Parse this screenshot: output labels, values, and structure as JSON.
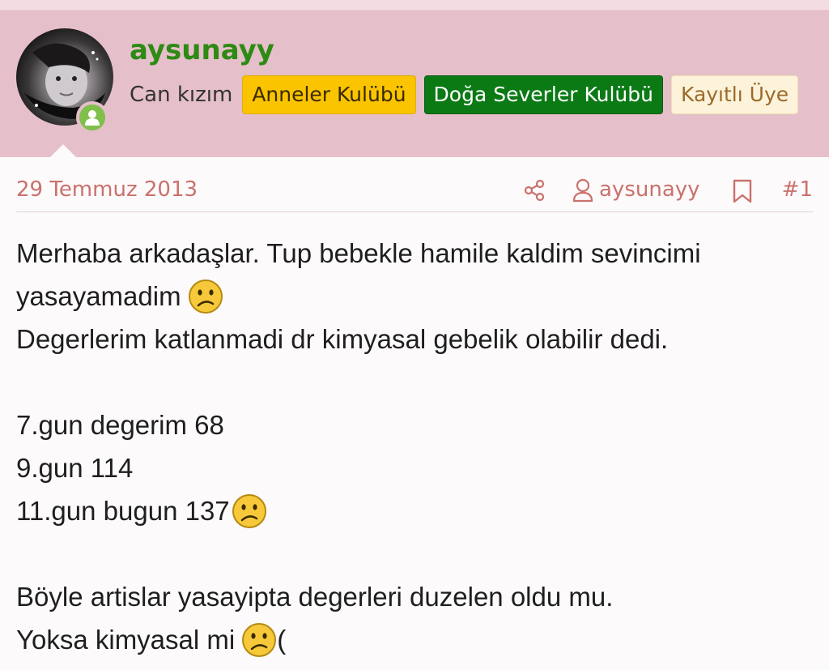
{
  "post": {
    "user": {
      "name": "aysunayy",
      "title": "Can kızım",
      "badges": [
        "Anneler Kulübü",
        "Doğa Severler Kulübü",
        "Kayıtlı Üye"
      ]
    },
    "date": "29 Temmuz 2013",
    "author_link": "aysunayy",
    "number": "#1",
    "lines": [
      "Merhaba arkadaşlar. Tup bebekle hamile kaldim sevincimi",
      "yasayamadim",
      "Degerlerim katlanmadi dr kimyasal gebelik olabilir dedi.",
      "7.gun degerim 68",
      "9.gun 114",
      "11.gun bugun 137",
      "Böyle artislar yasayipta degerleri duzelen oldu mu.",
      "Yoksa kimyasal mi",
      "("
    ]
  },
  "colors": {
    "header_bg": "#e5bfc9",
    "username": "#2d8a14",
    "meta_text": "#c9716d",
    "badge_anneler": "#fac400",
    "badge_doga": "#0b7a15",
    "badge_kayitli": "#fdf3da",
    "online": "#7fbf4a"
  },
  "icons": [
    "avatar",
    "online-status-icon",
    "share-icon",
    "user-icon",
    "bookmark-icon",
    "frown-emoji-icon"
  ]
}
